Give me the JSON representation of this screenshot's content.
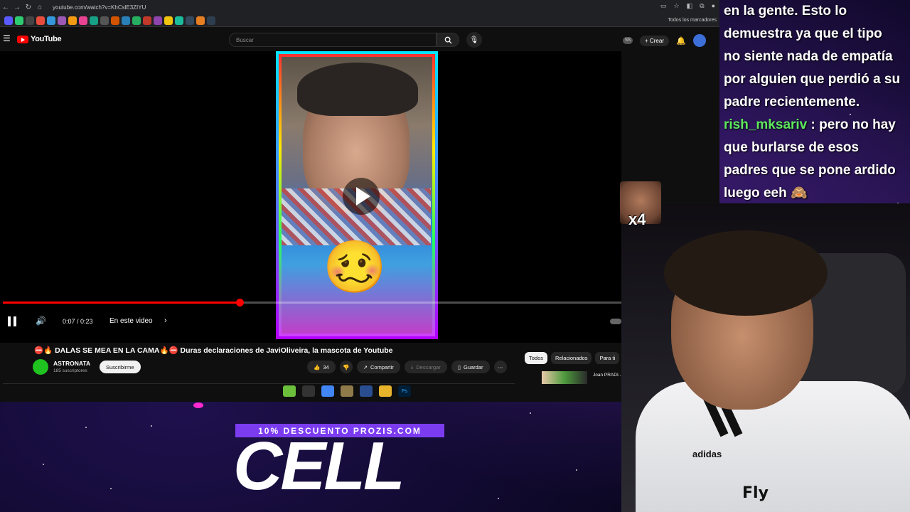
{
  "browser": {
    "url": "youtube.com/watch?v=KhCslE3ZIYU",
    "bookmarks_folder": "Todos los marcadores"
  },
  "youtube": {
    "logo_text": "YouTube",
    "search_placeholder": "Buscar",
    "ss_badge": "SS",
    "create_label": "Crear"
  },
  "player": {
    "time": "0:07 / 0:23",
    "chapter_label": "En este video",
    "progress": 0.383,
    "video_emoji": "🥴"
  },
  "video": {
    "title": "⛔🔥 DALAS SE MEA EN LA CAMA🔥⛔ Duras declaraciones de JaviOliveira, la mascota de Youtube",
    "channel_name": "ASTRONATA",
    "subscribers": "185 suscriptores",
    "subscribe_label": "Suscribirme",
    "likes": "34",
    "share_label": "Compartir",
    "download_label": "Descargar",
    "save_label": "Guardar"
  },
  "sidebar": {
    "chips": [
      "Todos",
      "Relacionados",
      "Para ti"
    ],
    "reco_title": "Joan PRADI... BOCA a TOD..."
  },
  "taskbar": {
    "ps_label": "Ps"
  },
  "chat": {
    "lines": [
      "en la gente. Esto lo",
      "demuestra ya que el tipo",
      "no siente nada de empatía",
      "por alguien que perdió a su",
      "padre recientemente."
    ],
    "msg2_user": "rish_mksariv",
    "msg2_sep": " : ",
    "msg2_lines": [
      "pero no hay",
      "que burlarse de esos",
      "padres que se pone ardido",
      "luego eeh 🙈"
    ]
  },
  "emote": {
    "count": "x4"
  },
  "webcam": {
    "adidas": "adidas",
    "fly": "Fly"
  },
  "promo": {
    "discount": "10% DESCUENTO PROZIS.COM",
    "big_text": "CELL"
  },
  "colors": {
    "accent_red": "#ff0000",
    "promo_purple": "#7b3cf0",
    "chat_user": "#5ee85e"
  }
}
